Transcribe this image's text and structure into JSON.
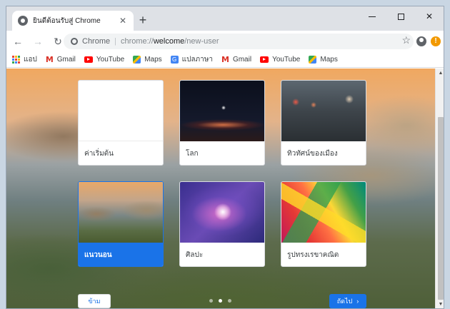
{
  "tab": {
    "title": "ยินดีต้อนรับสู่ Chrome",
    "close": "✕",
    "new_tab": "+"
  },
  "window_controls": {
    "close": "✕"
  },
  "toolbar": {
    "back": "←",
    "forward": "→",
    "reload": "↻",
    "site_label": "Chrome",
    "url_prefix": "chrome://",
    "url_host": "welcome",
    "url_path": "/new-user",
    "star": "☆",
    "update_badge": "!"
  },
  "bookmarks": [
    {
      "label": "แอป",
      "icon": "apps-grid-icon"
    },
    {
      "label": "Gmail",
      "icon": "gmail-icon",
      "glyph": "M"
    },
    {
      "label": "YouTube",
      "icon": "youtube-icon"
    },
    {
      "label": "Maps",
      "icon": "maps-icon"
    },
    {
      "label": "แปลภาษา",
      "icon": "translate-icon",
      "glyph": "G"
    },
    {
      "label": "Gmail",
      "icon": "gmail-icon",
      "glyph": "M"
    },
    {
      "label": "YouTube",
      "icon": "youtube-icon"
    },
    {
      "label": "Maps",
      "icon": "maps-icon"
    }
  ],
  "backgrounds": [
    {
      "label": "ค่าเริ่มต้น",
      "theme": "default",
      "selected": false
    },
    {
      "label": "โลก",
      "theme": "earth",
      "selected": false
    },
    {
      "label": "ทิวทัศน์ของเมือง",
      "theme": "city",
      "selected": false
    },
    {
      "label": "แนวนอน",
      "theme": "landscape",
      "selected": true
    },
    {
      "label": "ศิลปะ",
      "theme": "art",
      "selected": false
    },
    {
      "label": "รูปทรงเรขาคณิต",
      "theme": "geo",
      "selected": false
    }
  ],
  "footer": {
    "skip_label": "ข้าม",
    "next_label": "ถัดไป",
    "next_arrow": "›",
    "page_count": 3,
    "active_page": 2
  },
  "colors": {
    "accent": "#1a73e8",
    "update": "#f29900"
  }
}
